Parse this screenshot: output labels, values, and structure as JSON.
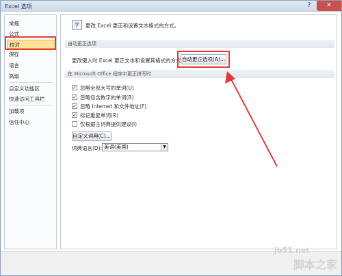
{
  "window": {
    "title": "Excel 选项",
    "help_glyph": "?",
    "close_glyph": "✕"
  },
  "sidebar": {
    "items": [
      {
        "label": "常规"
      },
      {
        "label": "公式"
      },
      {
        "label": "校对"
      },
      {
        "label": "保存"
      },
      {
        "label": "语言"
      },
      {
        "label": "高级"
      },
      {
        "label": "自定义功能区"
      },
      {
        "label": "快速访问工具栏"
      },
      {
        "label": "加载项"
      },
      {
        "label": "信任中心"
      }
    ],
    "active": "校对"
  },
  "main": {
    "header_text": "更改 Excel 更正和设置文本格式的方式。",
    "header_icon_glyph": "字",
    "autocorrect": {
      "section_title": "自动更正选项",
      "description": "更改键入时 Excel 更正文本和设置其格式的方式:",
      "button_label": "自动更正选项(A)..."
    },
    "spelling": {
      "section_title": "在 Microsoft Office 程序中更正拼写时",
      "options": [
        {
          "label": "忽略全部大写的单词(U)",
          "checked": true
        },
        {
          "label": "忽略包含数字的单词(B)",
          "checked": true
        },
        {
          "label": "忽略 Internet 和文件地址(F)",
          "checked": true
        },
        {
          "label": "标记重复单词(R)",
          "checked": true
        },
        {
          "label": "仅根据主词典提供建议(I)",
          "checked": false
        }
      ],
      "dictionary_button": "自定义词典(C)...",
      "language_label": "词典语言(D):",
      "language_value": "英语(美国)"
    }
  },
  "watermark": {
    "site": "jb51.net",
    "brand": "脚本之家"
  },
  "colors": {
    "highlight": "#e23a3a",
    "active_nav": "#fde29b"
  }
}
